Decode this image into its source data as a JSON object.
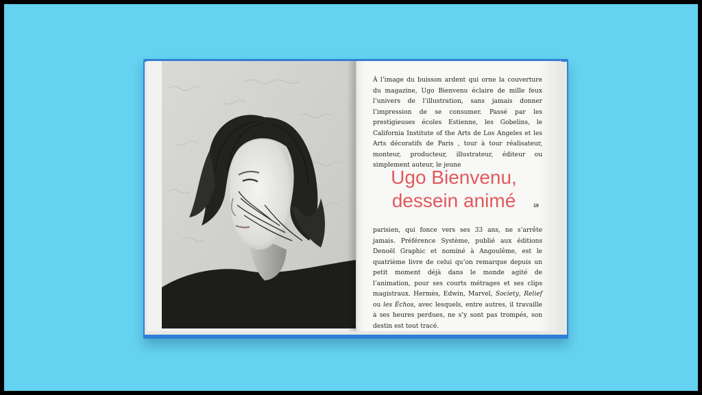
{
  "article": {
    "title_line1": "Ugo Bienvenu,",
    "title_line2": "dessein animé",
    "page_number": "19",
    "paragraph_top": "À l’image du buisson ardent qui orne la couverture du magazine, Ugo Bienvenu éclaire de mille feux l’univers de l’illustration, sans jamais donner l’impression de se consumer. Passé par les prestigieuses écoles Estienne, les Gobelins, le California Institute of the Arts de Los Angeles et les Arts décoratifs de Paris , tour à tour réalisateur, monteur, producteur, illustrateur, éditeur ou simplement auteur, le jeune",
    "paragraph_bottom_part1": "parisien, qui fonce vers ses 33 ans, ne s’arrête jamais. Préférence Système, publié aux éditions Denoël Graphic et nominé à Angoulême, est le quatrième livre de celui qu’on remarque depuis un petit moment déjà dans le monde agité de l’animation, pour ses courts métrages et ses clips magistraux. Hermès, Edwin, Marvel,",
    "paragraph_bottom_italic1": "Society",
    "paragraph_bottom_sep1": ",",
    "paragraph_bottom_italic2": "Relief",
    "paragraph_bottom_sep2": "ou",
    "paragraph_bottom_italic3": "les Échos",
    "paragraph_bottom_part2": ", avec lesquels, entre autres, il travaille à ses heures perdues, ne s’y sont pas trompés, son destin est tout tracé."
  },
  "colors": {
    "background": "#64d2f0",
    "cover": "#2f7fd6",
    "headline": "#e2595e"
  }
}
